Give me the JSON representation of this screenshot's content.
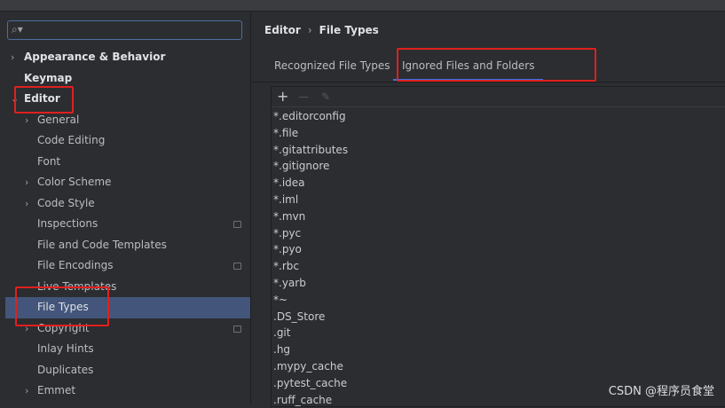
{
  "search": {
    "placeholder": ""
  },
  "tree": {
    "appearance": "Appearance & Behavior",
    "keymap": "Keymap",
    "editor": "Editor",
    "general": "General",
    "code_editing": "Code Editing",
    "font": "Font",
    "color_scheme": "Color Scheme",
    "code_style": "Code Style",
    "inspections": "Inspections",
    "file_code_templates": "File and Code Templates",
    "file_encodings": "File Encodings",
    "live_templates": "Live Templates",
    "file_types": "File Types",
    "copyright": "Copyright",
    "inlay_hints": "Inlay Hints",
    "duplicates": "Duplicates",
    "emmet": "Emmet"
  },
  "breadcrumb": {
    "root": "Editor",
    "separator": "›",
    "current": "File Types"
  },
  "tabs": {
    "recognized": "Recognized File Types",
    "ignored": "Ignored Files and Folders"
  },
  "toolbar": {
    "add": "+",
    "remove": "—",
    "edit": "✎"
  },
  "ignored": [
    "*.editorconfig",
    "*.file",
    "*.gitattributes",
    "*.gitignore",
    "*.idea",
    "*.iml",
    "*.mvn",
    "*.pyc",
    "*.pyo",
    "*.rbc",
    "*.yarb",
    "*~",
    ".DS_Store",
    ".git",
    ".hg",
    ".mypy_cache",
    ".pytest_cache",
    ".ruff_cache"
  ],
  "watermark": "CSDN @程序员食堂",
  "colors": {
    "selection": "#43557a",
    "accent": "#3574f0",
    "highlight_box": "#e0201e"
  }
}
